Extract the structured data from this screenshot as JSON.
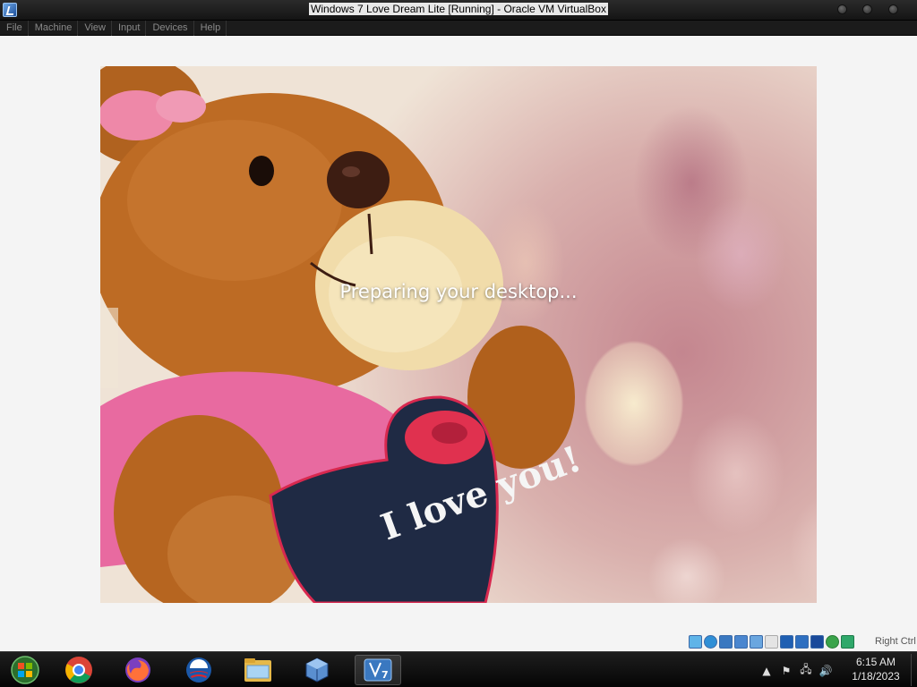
{
  "window": {
    "title": "Windows 7 Love Dream Lite [Running] - Oracle VM VirtualBox"
  },
  "menu": {
    "items": [
      "File",
      "Machine",
      "View",
      "Input",
      "Devices",
      "Help"
    ]
  },
  "guest": {
    "status_text": "Preparing your desktop...",
    "wallpaper_text": "I love you!"
  },
  "statusbar": {
    "icons": [
      "hard-disk-icon",
      "optical-drive-icon",
      "audio-icon",
      "network-icon",
      "usb-icon",
      "shared-folder-icon",
      "display-icon",
      "video-capture-icon",
      "cpu-icon",
      "mouse-integration-icon",
      "host-key-icon"
    ],
    "host_key": "Right Ctrl"
  },
  "taskbar": {
    "apps": [
      "start-orb-icon",
      "chrome-icon",
      "firefox-icon",
      "obama-logo-icon",
      "file-explorer-icon",
      "virtualbox-icon",
      "windows7-vm-icon"
    ],
    "active_app": "windows7-vm-icon",
    "tray_icons": [
      "show-hidden-icons-icon",
      "action-center-flag-icon",
      "network-icon",
      "volume-icon"
    ],
    "clock_time": "6:15 AM",
    "clock_date": "1/18/2023"
  },
  "colors": {
    "titlebar": "#1e1e1e",
    "vm_background": "#f4f4f4",
    "taskbar": "#0a0a0a"
  }
}
